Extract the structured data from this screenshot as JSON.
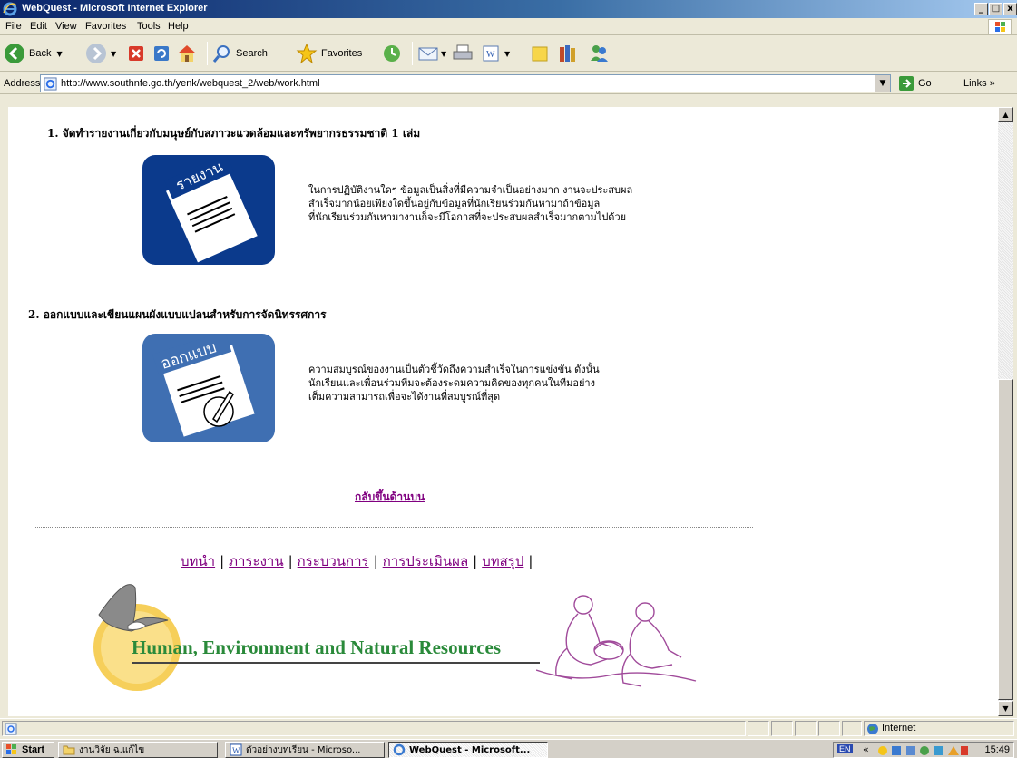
{
  "window": {
    "title": "WebQuest - Microsoft Internet Explorer",
    "controls": [
      "_",
      "□",
      "x"
    ]
  },
  "menu": [
    "File",
    "Edit",
    "View",
    "Favorites",
    "Tools",
    "Help"
  ],
  "toolbar": {
    "back_label": "Back",
    "search_label": "Search",
    "favorites_label": "Favorites"
  },
  "address": {
    "label": "Address",
    "url": "http://www.southnfe.go.th/yenk/webquest_2/web/work.html",
    "go_label": "Go",
    "links_label": "Links"
  },
  "content": {
    "item1": {
      "heading": "1.  จัดทำรายงานเกี่ยวกับมนุษย์กับสภาวะแวดล้อมและทรัพยากรธรรมชาติ  1 เล่ม",
      "icon_text": "รายงาน",
      "lines": [
        "ในการปฏิบัติงานใดๆ ข้อมูลเป็นสิ่งที่มีความจำเป็นอย่างมาก  งานจะประสบผล",
        "สำเร็จมากน้อยเพียงใดขึ้นอยู่กับข้อมูลที่นักเรียนร่วมกันหามาถ้าข้อมูล",
        "ที่นักเรียนร่วมกันหามางานก็จะมีโอกาสที่จะประสบผลสำเร็จมากตามไปด้วย"
      ]
    },
    "item2": {
      "heading": "2.  ออกแบบและเขียนแผนผังแบบแปลนสำหรับการจัดนิทรรศการ",
      "icon_text": "ออกแบบ",
      "lines": [
        "ความสมบูรณ์ของงานเป็นตัวชี้วัดถึงความสำเร็จในการแข่งขัน  ดังนั้น",
        "นักเรียนและเพื่อนร่วมทีมจะต้องระดมความคิดของทุกคนในทีมอย่าง",
        "เต็มความสามารถเพื่อจะได้งานที่สมบูรณ์ที่สุด"
      ]
    },
    "back_to_top": "กลับขึ้นด้านบน",
    "nav": [
      "บทนำ",
      "ภาระงาน",
      "กระบวนการ",
      "การประเมินผล",
      "บทสรุป"
    ],
    "banner_title": "Human, Environment and Natural Resources"
  },
  "statusbar": {
    "zone": "Internet"
  },
  "taskbar": {
    "start": "Start",
    "tasks": [
      "งานวิจัย ฉ.แก้ไข",
      "ตัวอย่างบทเรียน - Microso...",
      "WebQuest - Microsoft..."
    ],
    "lang": "EN",
    "clock": "15:49"
  },
  "colors": {
    "titlebar": "#0a246a",
    "link_visited": "#800080",
    "icon_blue_dark": "#0b3a8c",
    "icon_blue_light": "#3f6fb2",
    "banner_green": "#2a8a3a"
  }
}
